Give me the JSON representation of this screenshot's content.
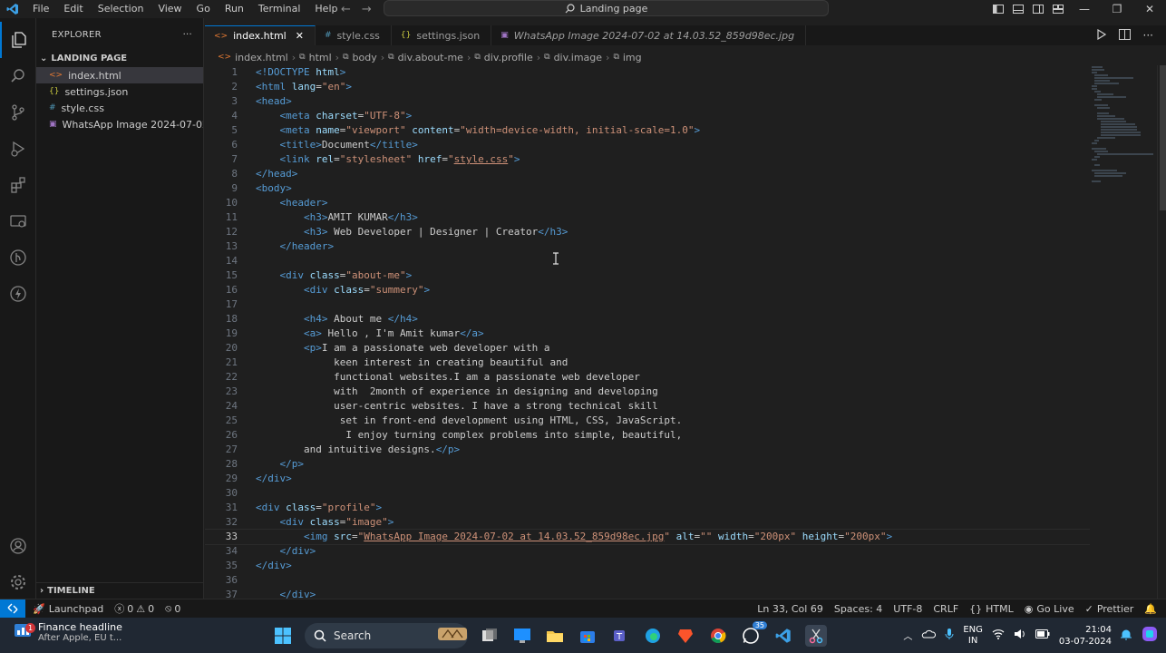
{
  "menu": [
    "File",
    "Edit",
    "Selection",
    "View",
    "Go",
    "Run",
    "Terminal",
    "Help"
  ],
  "command_center": "Landing page",
  "explorer": {
    "title": "EXPLORER",
    "section": "LANDING PAGE",
    "files": [
      {
        "name": "index.html",
        "icon": "html-file-icon",
        "color": "#e37933"
      },
      {
        "name": "settings.json",
        "icon": "json-file-icon",
        "color": "#cbcb41"
      },
      {
        "name": "style.css",
        "icon": "css-file-icon",
        "color": "#519aba"
      },
      {
        "name": "WhatsApp Image 2024-07-02 ...",
        "icon": "image-file-icon",
        "color": "#a074c4"
      }
    ],
    "timeline": "TIMELINE"
  },
  "tabs": [
    {
      "label": "index.html",
      "glyph": "<>",
      "color": "#e37933",
      "active": true
    },
    {
      "label": "style.css",
      "glyph": "#",
      "color": "#519aba"
    },
    {
      "label": "settings.json",
      "glyph": "{}",
      "color": "#cbcb41"
    },
    {
      "label": "WhatsApp Image 2024-07-02 at 14.03.52_859d98ec.jpg",
      "glyph": "▣",
      "color": "#a074c4",
      "italic": true
    }
  ],
  "breadcrumb": [
    "index.html",
    "html",
    "body",
    "div.about-me",
    "div.profile",
    "div.image",
    "img"
  ],
  "code_lines": [
    {
      "n": "1",
      "t": [
        [
          "tag",
          "<!DOCTYPE "
        ],
        [
          "attr",
          "html"
        ],
        [
          "tag",
          ">"
        ]
      ]
    },
    {
      "n": "2",
      "t": [
        [
          "tag",
          "<html "
        ],
        [
          "attr",
          "lang"
        ],
        [
          "txt",
          "="
        ],
        [
          "val",
          "\"en\""
        ],
        [
          "tag",
          ">"
        ]
      ]
    },
    {
      "n": "3",
      "t": [
        [
          "tag",
          "<head>"
        ]
      ]
    },
    {
      "n": "4",
      "t": [
        [
          "txt",
          "    "
        ],
        [
          "tag",
          "<meta "
        ],
        [
          "attr",
          "charset"
        ],
        [
          "txt",
          "="
        ],
        [
          "val",
          "\"UTF-8\""
        ],
        [
          "tag",
          ">"
        ]
      ]
    },
    {
      "n": "5",
      "t": [
        [
          "txt",
          "    "
        ],
        [
          "tag",
          "<meta "
        ],
        [
          "attr",
          "name"
        ],
        [
          "txt",
          "="
        ],
        [
          "val",
          "\"viewport\""
        ],
        [
          "txt",
          " "
        ],
        [
          "attr",
          "content"
        ],
        [
          "txt",
          "="
        ],
        [
          "val",
          "\"width=device-width, initial-scale=1.0\""
        ],
        [
          "tag",
          ">"
        ]
      ]
    },
    {
      "n": "6",
      "t": [
        [
          "txt",
          "    "
        ],
        [
          "tag",
          "<title>"
        ],
        [
          "txt",
          "Document"
        ],
        [
          "tag",
          "</title>"
        ]
      ]
    },
    {
      "n": "7",
      "t": [
        [
          "txt",
          "    "
        ],
        [
          "tag",
          "<link "
        ],
        [
          "attr",
          "rel"
        ],
        [
          "txt",
          "="
        ],
        [
          "val",
          "\"stylesheet\""
        ],
        [
          "txt",
          " "
        ],
        [
          "attr",
          "href"
        ],
        [
          "txt",
          "="
        ],
        [
          "val",
          "\""
        ],
        [
          "valu",
          "style.css"
        ],
        [
          "val",
          "\""
        ],
        [
          "tag",
          ">"
        ]
      ]
    },
    {
      "n": "8",
      "t": [
        [
          "tag",
          "</head>"
        ]
      ]
    },
    {
      "n": "9",
      "t": [
        [
          "tag",
          "<body>"
        ]
      ]
    },
    {
      "n": "10",
      "t": [
        [
          "txt",
          "    "
        ],
        [
          "tag",
          "<header>"
        ]
      ]
    },
    {
      "n": "11",
      "t": [
        [
          "txt",
          "        "
        ],
        [
          "tag",
          "<h3>"
        ],
        [
          "txt",
          "AMIT KUMAR"
        ],
        [
          "tag",
          "</h3>"
        ]
      ]
    },
    {
      "n": "12",
      "t": [
        [
          "txt",
          "        "
        ],
        [
          "tag",
          "<h3>"
        ],
        [
          "txt",
          " Web Developer | Designer | Creator"
        ],
        [
          "tag",
          "</h3>"
        ]
      ]
    },
    {
      "n": "13",
      "t": [
        [
          "txt",
          "    "
        ],
        [
          "tag",
          "</header>"
        ]
      ]
    },
    {
      "n": "14",
      "t": []
    },
    {
      "n": "15",
      "t": [
        [
          "txt",
          "    "
        ],
        [
          "tag",
          "<div "
        ],
        [
          "attr",
          "class"
        ],
        [
          "txt",
          "="
        ],
        [
          "val",
          "\"about-me\""
        ],
        [
          "tag",
          ">"
        ]
      ]
    },
    {
      "n": "16",
      "t": [
        [
          "txt",
          "        "
        ],
        [
          "tag",
          "<div "
        ],
        [
          "attr",
          "class"
        ],
        [
          "txt",
          "="
        ],
        [
          "val",
          "\"summery\""
        ],
        [
          "tag",
          ">"
        ]
      ]
    },
    {
      "n": "17",
      "t": []
    },
    {
      "n": "18",
      "t": [
        [
          "txt",
          "        "
        ],
        [
          "tag",
          "<h4>"
        ],
        [
          "txt",
          " About me "
        ],
        [
          "tag",
          "</h4>"
        ]
      ]
    },
    {
      "n": "19",
      "t": [
        [
          "txt",
          "        "
        ],
        [
          "tag",
          "<a>"
        ],
        [
          "txt",
          " Hello , I'm Amit kumar"
        ],
        [
          "tag",
          "</a>"
        ]
      ]
    },
    {
      "n": "20",
      "t": [
        [
          "txt",
          "        "
        ],
        [
          "tag",
          "<p>"
        ],
        [
          "txt",
          "I am a passionate web developer with a"
        ]
      ]
    },
    {
      "n": "21",
      "t": [
        [
          "txt",
          "             keen interest in creating beautiful and"
        ]
      ]
    },
    {
      "n": "22",
      "t": [
        [
          "txt",
          "             functional websites.I am a passionate web developer"
        ]
      ]
    },
    {
      "n": "23",
      "t": [
        [
          "txt",
          "             with  2month of experience in designing and developing"
        ]
      ]
    },
    {
      "n": "24",
      "t": [
        [
          "txt",
          "             user-centric websites. I have a strong technical skill"
        ]
      ]
    },
    {
      "n": "25",
      "t": [
        [
          "txt",
          "              set in front-end development using HTML, CSS, JavaScript."
        ]
      ]
    },
    {
      "n": "26",
      "t": [
        [
          "txt",
          "               I enjoy turning complex problems into simple, beautiful,"
        ]
      ]
    },
    {
      "n": "27",
      "t": [
        [
          "txt",
          "        and intuitive designs."
        ],
        [
          "tag",
          "</p>"
        ]
      ]
    },
    {
      "n": "28",
      "t": [
        [
          "txt",
          "    "
        ],
        [
          "tag",
          "</p>"
        ]
      ]
    },
    {
      "n": "29",
      "t": [
        [
          "tag",
          "</div>"
        ]
      ]
    },
    {
      "n": "30",
      "t": []
    },
    {
      "n": "31",
      "t": [
        [
          "tag",
          "<div "
        ],
        [
          "attr",
          "class"
        ],
        [
          "txt",
          "="
        ],
        [
          "val",
          "\"profile\""
        ],
        [
          "tag",
          ">"
        ]
      ]
    },
    {
      "n": "32",
      "t": [
        [
          "txt",
          "    "
        ],
        [
          "tag",
          "<div "
        ],
        [
          "attr",
          "class"
        ],
        [
          "txt",
          "="
        ],
        [
          "val",
          "\"image\""
        ],
        [
          "tag",
          ">"
        ]
      ]
    },
    {
      "n": "33",
      "t": [
        [
          "txt",
          "        "
        ],
        [
          "tag",
          "<img "
        ],
        [
          "attr",
          "src"
        ],
        [
          "txt",
          "="
        ],
        [
          "val",
          "\""
        ],
        [
          "valu",
          "WhatsApp Image 2024-07-02 at 14.03.52_859d98ec.jpg"
        ],
        [
          "val",
          "\""
        ],
        [
          "txt",
          " "
        ],
        [
          "attr",
          "alt"
        ],
        [
          "txt",
          "="
        ],
        [
          "val",
          "\"\""
        ],
        [
          "txt",
          " "
        ],
        [
          "attr",
          "width"
        ],
        [
          "txt",
          "="
        ],
        [
          "val",
          "\"200px\""
        ],
        [
          "txt",
          " "
        ],
        [
          "attr",
          "height"
        ],
        [
          "txt",
          "="
        ],
        [
          "val",
          "\"200px\""
        ],
        [
          "tag",
          ">"
        ]
      ],
      "current": true
    },
    {
      "n": "34",
      "t": [
        [
          "txt",
          "    "
        ],
        [
          "tag",
          "</div>"
        ]
      ]
    },
    {
      "n": "35",
      "t": [
        [
          "tag",
          "</div>"
        ]
      ]
    },
    {
      "n": "36",
      "t": []
    },
    {
      "n": "37",
      "t": [
        [
          "txt",
          "    "
        ],
        [
          "tag",
          "</div>"
        ]
      ]
    }
  ],
  "status": {
    "launchpad": "Launchpad",
    "errors": "0",
    "warnings": "0",
    "ports": "0",
    "position": "Ln 33, Col 69",
    "spaces": "Spaces: 4",
    "encoding": "UTF-8",
    "eol": "CRLF",
    "language": "HTML",
    "golive": "Go Live",
    "prettier": "Prettier"
  },
  "taskbar": {
    "news_title": "Finance headline",
    "news_sub": "After Apple, EU t...",
    "news_badge": "1",
    "search": "Search",
    "whatsapp_badge": "35",
    "lang1": "ENG",
    "lang2": "IN",
    "time": "21:04",
    "date": "03-07-2024"
  }
}
